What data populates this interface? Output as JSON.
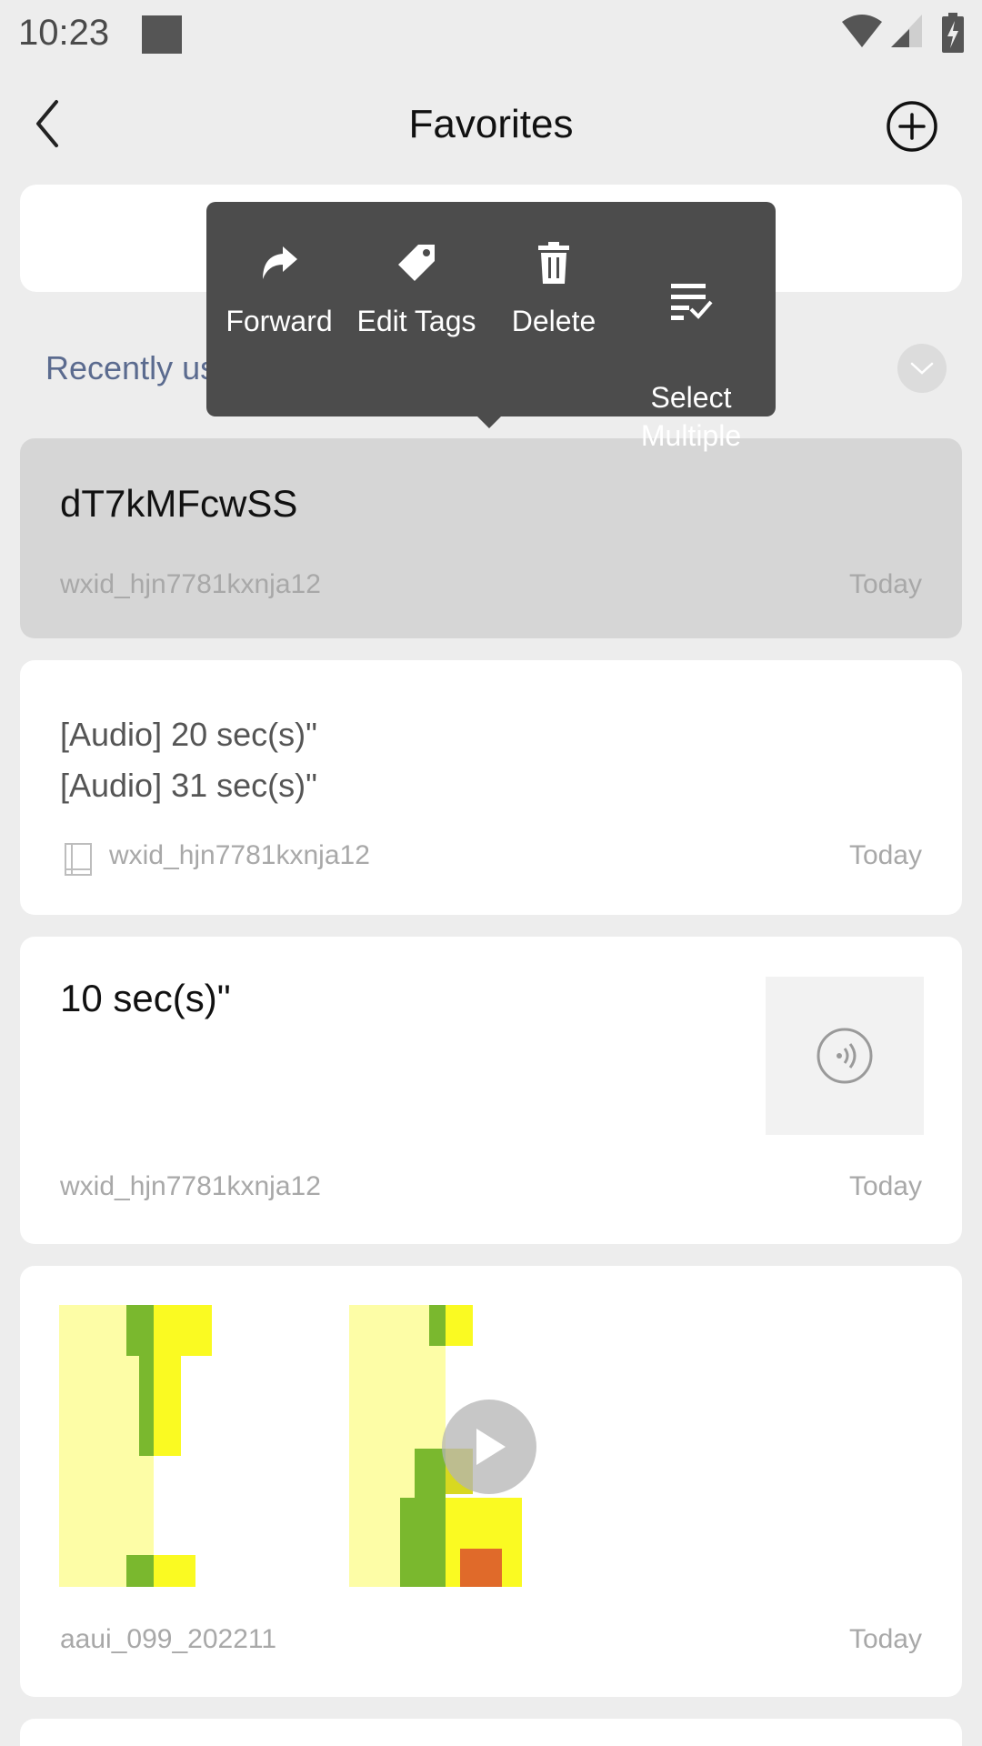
{
  "status_bar": {
    "time": "10:23"
  },
  "header": {
    "title": "Favorites"
  },
  "recently_used": {
    "label": "Recently us"
  },
  "context_menu": {
    "items": [
      {
        "label": "Forward",
        "icon": "forward-icon"
      },
      {
        "label": "Edit Tags",
        "icon": "tag-icon"
      },
      {
        "label": "Delete",
        "icon": "trash-icon"
      },
      {
        "label": "Select\nMultiple",
        "icon": "select-multiple-icon"
      }
    ]
  },
  "favorites": [
    {
      "title": "dT7kMFcwSS",
      "source": "wxid_hjn7781kxnja12",
      "date": "Today"
    },
    {
      "lines": [
        "[Audio] 20 sec(s)\"",
        "[Audio] 31 sec(s)\""
      ],
      "source": "wxid_hjn7781kxnja12",
      "date": "Today",
      "icon": "note-icon"
    },
    {
      "title": "10 sec(s)\"",
      "source": "wxid_hjn7781kxnja12",
      "date": "Today",
      "icon": "voice-icon"
    },
    {
      "source": "aaui_099_202211",
      "date": "Today",
      "icon": "play-icon"
    }
  ],
  "colors": {
    "background": "#ededed",
    "menu": "#4c4c4c",
    "recent_label": "#5b6b8f",
    "highlight": "#d6d6d6"
  }
}
